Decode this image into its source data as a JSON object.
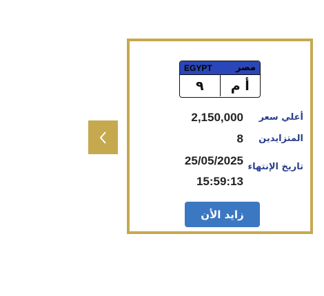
{
  "colors": {
    "gold": "#c6a94f",
    "plate_blue": "#2a46b8",
    "label_blue": "#2a3f8a",
    "button_blue": "#3c77c2"
  },
  "nav": {
    "prev_icon": "chevron-left-icon"
  },
  "plate": {
    "country_en": "EGYPT",
    "country_ar": "مصر",
    "number": "٩",
    "letters": "أ م"
  },
  "details": {
    "highest_bid_label": "أعلي سعر",
    "highest_bid_value": "2,150,000",
    "bidders_label": "المتزايدين",
    "bidders_value": "8",
    "expiry_label": "تاريخ الإنتهاء",
    "expiry_date": "25/05/2025",
    "expiry_time": "15:59:13"
  },
  "actions": {
    "bid_now_label": "زايد الأن"
  }
}
